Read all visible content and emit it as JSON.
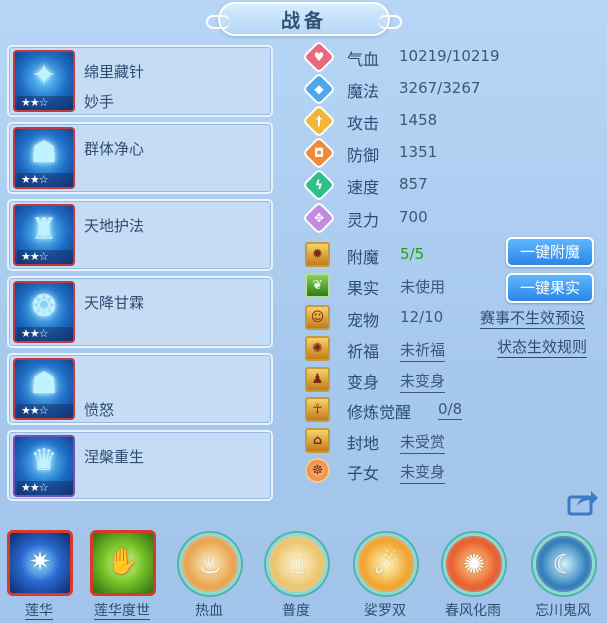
{
  "title": "战备",
  "skills": [
    {
      "name": "绵里藏针",
      "sub": "妙手",
      "icon": "needle-skill-icon",
      "glyph": "✦",
      "frame": "red"
    },
    {
      "name": "群体净心",
      "sub": "",
      "icon": "helmet-skill-icon",
      "glyph": "☗",
      "frame": "red"
    },
    {
      "name": "天地护法",
      "sub": "",
      "icon": "guardian-skill-icon",
      "glyph": "♜",
      "frame": "red"
    },
    {
      "name": "天降甘霖",
      "sub": "",
      "icon": "rain-skill-icon",
      "glyph": "❂",
      "frame": "red"
    },
    {
      "name": "",
      "sub": "愤怒",
      "icon": "mask-skill-icon",
      "glyph": "☗",
      "frame": "red"
    },
    {
      "name": "涅槃重生",
      "sub": "",
      "icon": "rebirth-skill-icon",
      "glyph": "♛",
      "frame": "purple"
    }
  ],
  "stars": "★★☆",
  "attributes": [
    {
      "label": "气血",
      "value": "10219/10219",
      "color": "#e86a7a",
      "icon": "heart-icon",
      "glyph": "♥"
    },
    {
      "label": "魔法",
      "value": "3267/3267",
      "color": "#4fa6e8",
      "icon": "magic-icon",
      "glyph": "◆"
    },
    {
      "label": "攻击",
      "value": "1458",
      "color": "#f2b63a",
      "icon": "sword-icon",
      "glyph": "†"
    },
    {
      "label": "防御",
      "value": "1351",
      "color": "#f08a3a",
      "icon": "shield-icon",
      "glyph": "◘"
    },
    {
      "label": "速度",
      "value": "857",
      "color": "#2fc08a",
      "icon": "lightning-icon",
      "glyph": "ϟ"
    },
    {
      "label": "灵力",
      "value": "700",
      "color": "#c489e0",
      "icon": "spirit-icon",
      "glyph": "✥"
    }
  ],
  "statuses": [
    {
      "label": "附魔",
      "value": "5/5",
      "style": "green",
      "icon": "enchant-icon",
      "glyph": "✹"
    },
    {
      "label": "果实",
      "value": "未使用",
      "style": "plain",
      "icon": "fruit-icon",
      "glyph": "❦"
    },
    {
      "label": "宠物",
      "value": "12/10",
      "style": "plain",
      "icon": "pet-icon",
      "glyph": "☺"
    },
    {
      "label": "祈福",
      "value": "未祈福",
      "style": "link",
      "icon": "blessing-icon",
      "glyph": "✺"
    },
    {
      "label": "变身",
      "value": "未变身",
      "style": "link",
      "icon": "transform-icon",
      "glyph": "♟"
    },
    {
      "label": "修炼觉醒",
      "value": "0/8",
      "style": "link",
      "icon": "awaken-icon",
      "glyph": "☥"
    },
    {
      "label": "封地",
      "value": "未受赏",
      "style": "link",
      "icon": "fief-icon",
      "glyph": "⌂"
    },
    {
      "label": "子女",
      "value": "未变身",
      "style": "link",
      "icon": "child-icon",
      "glyph": "☸"
    }
  ],
  "buttons": {
    "enchant": "一键附魔",
    "fruit": "一键果实"
  },
  "links": {
    "event_preset": "赛事不生效预设",
    "status_rules": "状态生效规则"
  },
  "bottom_skills": [
    {
      "name": "莲华",
      "icon": "lotus-icon",
      "glyph": "✷",
      "style": "square",
      "bg": "#1a4aa8",
      "underline": true
    },
    {
      "name": "莲华度世",
      "icon": "hand-lotus-icon",
      "glyph": "✋",
      "style": "square",
      "bg": "#4a9a1c",
      "underline": true
    },
    {
      "name": "热血",
      "icon": "hot-blood-icon",
      "glyph": "♨",
      "style": "round",
      "bg": "#e7a24a",
      "underline": false
    },
    {
      "name": "普度",
      "icon": "salvation-icon",
      "glyph": "☝",
      "style": "round",
      "bg": "#ebc46a",
      "underline": false
    },
    {
      "name": "娑罗双",
      "icon": "sala-icon",
      "glyph": "☄",
      "style": "round",
      "bg": "#f0a22a",
      "underline": false
    },
    {
      "name": "春风化雨",
      "icon": "spring-wind-icon",
      "glyph": "✺",
      "style": "round",
      "bg": "#e85a2a",
      "underline": false
    },
    {
      "name": "忘川鬼风",
      "icon": "ghost-wind-icon",
      "glyph": "☾",
      "style": "round",
      "bg": "#2a7ab8",
      "underline": false
    }
  ]
}
